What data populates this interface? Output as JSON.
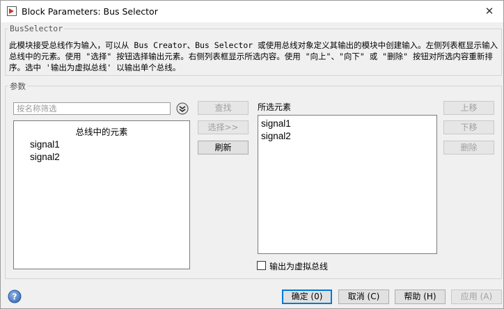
{
  "window": {
    "title": "Block Parameters: Bus Selector",
    "close_glyph": "✕"
  },
  "block": {
    "name": "BusSelector",
    "description": "此模块接受总线作为输入，可以从 Bus Creator、Bus Selector 或使用总线对象定义其输出的模块中创建输入。左侧列表框显示输入总线中的元素。使用 \"选择\" 按钮选择输出元素。右侧列表框显示所选内容。使用 \"向上\"、\"向下\" 或 \"删除\" 按钮对所选内容重新排序。选中 '输出为虚拟总线' 以输出单个总线。"
  },
  "params": {
    "legend": "参数",
    "filter_placeholder": "按名称筛选",
    "filter_value": "",
    "bus_elements_header": "总线中的元素",
    "bus_elements": [
      "signal1",
      "signal2"
    ],
    "find_label": "查找",
    "select_label": "选择>>",
    "refresh_label": "刷新",
    "selected_header": "所选元素",
    "selected_elements": [
      "signal1",
      "signal2"
    ],
    "up_label": "上移",
    "down_label": "下移",
    "remove_label": "删除",
    "virtual_bus_label": "输出为虚拟总线",
    "virtual_bus_checked": false
  },
  "footer": {
    "ok_label": "确定 (0)",
    "cancel_label": "取消 (C)",
    "help_label": "帮助 (H)",
    "apply_label": "应用 (A)"
  },
  "icons": {
    "app": "simulink-block-icon",
    "help": "help-icon",
    "dropdown": "chevron-down-icon"
  },
  "colors": {
    "accent": "#0078d7",
    "help_icon": "#3b6fb6"
  }
}
